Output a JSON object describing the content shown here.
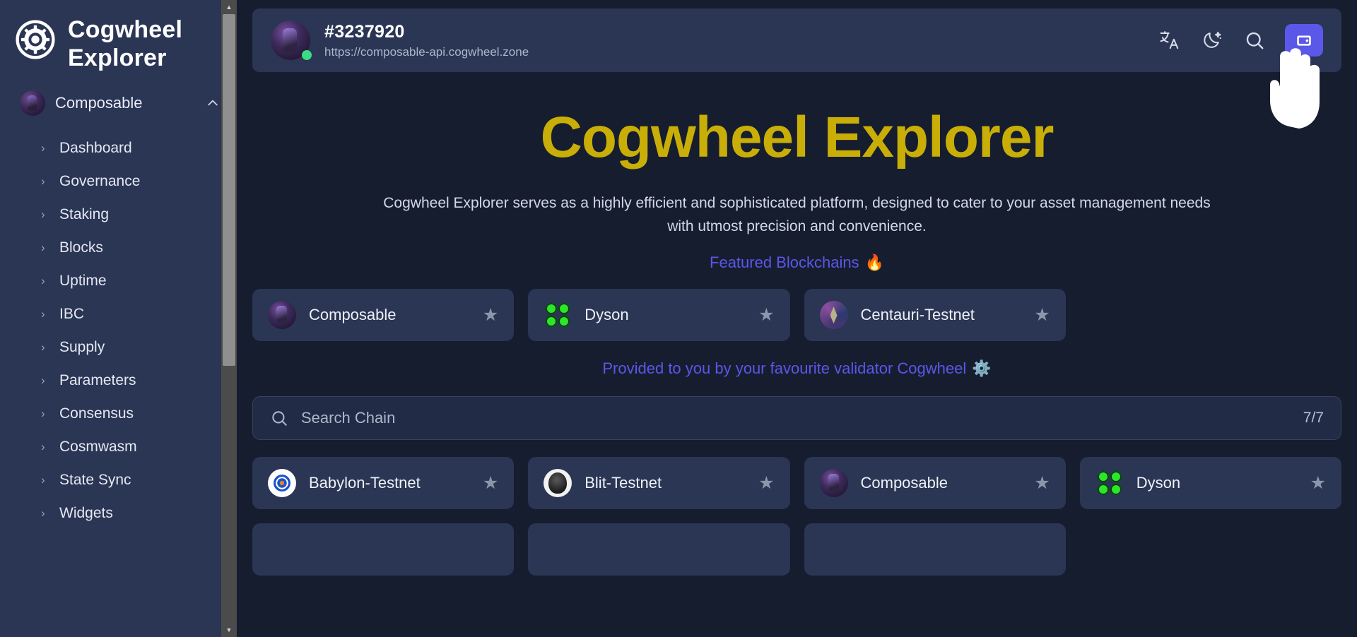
{
  "brand": {
    "title": "Cogwheel Explorer",
    "logo_icon": "cogwheel-icon"
  },
  "sidebar": {
    "chain_selector": {
      "label": "Composable",
      "avatar": "composable-avatar",
      "chevron": "chevron-up-icon"
    },
    "items": [
      {
        "label": "Dashboard",
        "chevron": "chevron-right-icon"
      },
      {
        "label": "Governance",
        "chevron": "chevron-right-icon"
      },
      {
        "label": "Staking",
        "chevron": "chevron-right-icon"
      },
      {
        "label": "Blocks",
        "chevron": "chevron-right-icon"
      },
      {
        "label": "Uptime",
        "chevron": "chevron-right-icon"
      },
      {
        "label": "IBC",
        "chevron": "chevron-right-icon"
      },
      {
        "label": "Supply",
        "chevron": "chevron-right-icon"
      },
      {
        "label": "Parameters",
        "chevron": "chevron-right-icon"
      },
      {
        "label": "Consensus",
        "chevron": "chevron-right-icon"
      },
      {
        "label": "Cosmwasm",
        "chevron": "chevron-right-icon"
      },
      {
        "label": "State Sync",
        "chevron": "chevron-right-icon"
      },
      {
        "label": "Widgets",
        "chevron": "chevron-right-icon"
      }
    ]
  },
  "topbar": {
    "node_id": "#3237920",
    "node_url": "https://composable-api.cogwheel.zone",
    "status": "online",
    "actions": [
      {
        "name": "translate-icon",
        "title": "Language"
      },
      {
        "name": "moon-icon",
        "title": "Dark mode"
      },
      {
        "name": "search-icon",
        "title": "Search"
      }
    ],
    "wallet_button": {
      "name": "wallet-icon",
      "title": "Connect Wallet",
      "color": "#5b57e8"
    }
  },
  "hero": {
    "title": "Cogwheel Explorer",
    "title_color": "#c9ae07",
    "description": "Cogwheel Explorer serves as a highly efficient and sophisticated platform, designed to cater to your asset management needs with utmost precision and convenience.",
    "featured_link": "Featured Blockchains",
    "featured_emoji": "🔥",
    "featured_color": "#5b57e8"
  },
  "featured_chains": [
    {
      "label": "Composable",
      "logo": "composable-logo",
      "star": "star-icon"
    },
    {
      "label": "Dyson",
      "logo": "dyson-logo",
      "star": "star-icon"
    },
    {
      "label": "Centauri-Testnet",
      "logo": "centauri-logo",
      "star": "star-icon"
    }
  ],
  "provider_note": {
    "text": "Provided to you by your favourite validator Cogwheel",
    "emoji": "⚙️",
    "color": "#5b57e8"
  },
  "search": {
    "placeholder": "Search Chain",
    "value": "",
    "count": "7/7",
    "icon": "search-icon"
  },
  "chains": [
    {
      "label": "Babylon-Testnet",
      "logo": "babylon-logo",
      "star": "star-icon"
    },
    {
      "label": "Blit-Testnet",
      "logo": "blit-logo",
      "star": "star-icon"
    },
    {
      "label": "Composable",
      "logo": "composable-logo",
      "star": "star-icon"
    },
    {
      "label": "Dyson",
      "logo": "dyson-logo",
      "star": "star-icon"
    }
  ],
  "chains_partial_row": [
    {
      "label": "",
      "logo": "chain-logo",
      "star": "star-icon"
    },
    {
      "label": "",
      "logo": "chain-logo",
      "star": "star-icon"
    },
    {
      "label": "",
      "logo": "chain-logo",
      "star": "star-icon"
    }
  ],
  "cursor": {
    "name": "pointing-hand-cursor"
  }
}
